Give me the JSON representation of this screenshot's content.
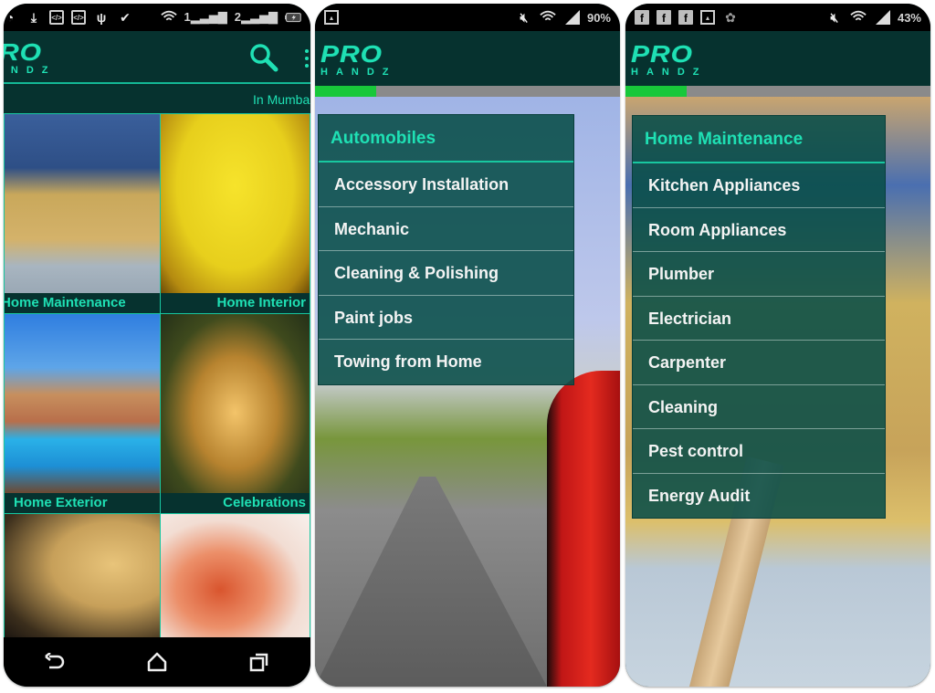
{
  "brand": {
    "logo_top": "PRO",
    "logo_bottom": "HANDZ",
    "accent": "#1fe0b4",
    "dark": "#06322f"
  },
  "screen1": {
    "status": {
      "left_icons": [
        "cast-icon",
        "download-icon",
        "code-icon",
        "code-icon",
        "usb-icon",
        "clipboard-check-icon"
      ],
      "sim1": "1",
      "sim2": "2",
      "battery": "charging"
    },
    "location_text": "In Mumbai",
    "tiles": [
      {
        "label": "Home Maintenance"
      },
      {
        "label": "Home Interior"
      },
      {
        "label": "Home Exterior"
      },
      {
        "label": "Celebrations"
      },
      {
        "label": ""
      },
      {
        "label": ""
      }
    ],
    "nav": [
      "back",
      "home",
      "recents"
    ]
  },
  "screen2": {
    "status": {
      "battery_text": "90%"
    },
    "progress": 0.2,
    "menu": {
      "title": "Automobiles",
      "items": [
        "Accessory Installation",
        "Mechanic",
        "Cleaning & Polishing",
        "Paint jobs",
        "Towing from Home"
      ]
    }
  },
  "screen3": {
    "status": {
      "left_icons": [
        "facebook-icon",
        "facebook-icon",
        "facebook-icon",
        "image-icon",
        "android-icon"
      ],
      "battery_text": "43%",
      "fb": "f"
    },
    "progress": 0.2,
    "menu": {
      "title": "Home Maintenance",
      "items": [
        "Kitchen Appliances",
        "Room Appliances",
        "Plumber",
        "Electrician",
        "Carpenter",
        "Cleaning",
        "Pest control",
        "Energy Audit"
      ]
    }
  }
}
